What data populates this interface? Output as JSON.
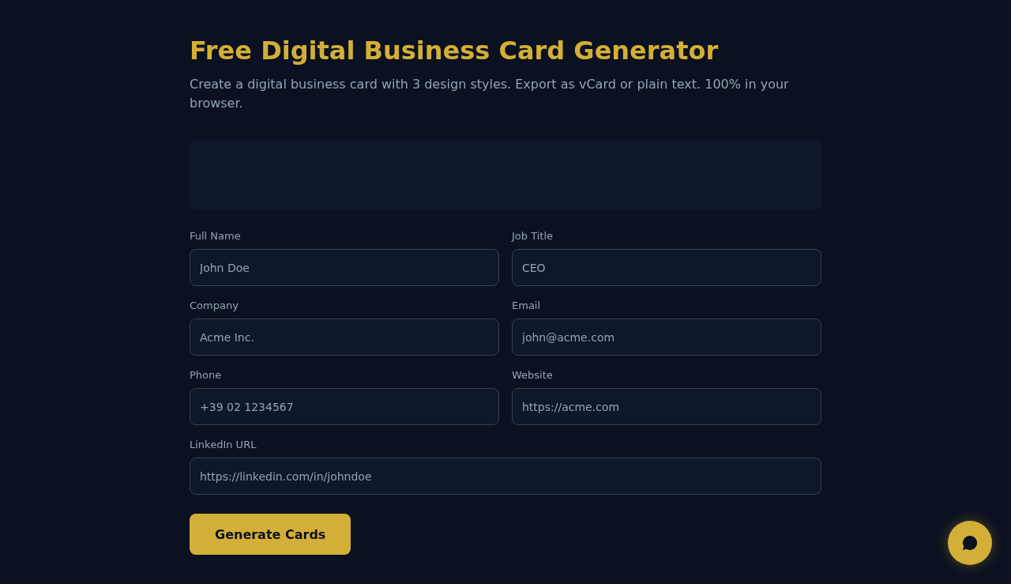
{
  "header": {
    "title": "Free Digital Business Card Generator",
    "subtitle": "Create a digital business card with 3 design styles. Export as vCard or plain text. 100% in your browser."
  },
  "form": {
    "fields": [
      {
        "label": "Full Name",
        "placeholder": "John Doe",
        "kind": "half"
      },
      {
        "label": "Job Title",
        "placeholder": "CEO",
        "kind": "half"
      },
      {
        "label": "Company",
        "placeholder": "Acme Inc.",
        "kind": "half"
      },
      {
        "label": "Email",
        "placeholder": "john@acme.com",
        "kind": "half"
      },
      {
        "label": "Phone",
        "placeholder": "+39 02 1234567",
        "kind": "half"
      },
      {
        "label": "Website",
        "placeholder": "https://acme.com",
        "kind": "half"
      },
      {
        "label": "LinkedIn URL",
        "placeholder": "https://linkedin.com/in/johndoe",
        "kind": "full"
      }
    ],
    "submit_button": {
      "label": "Generate Cards"
    }
  }
}
